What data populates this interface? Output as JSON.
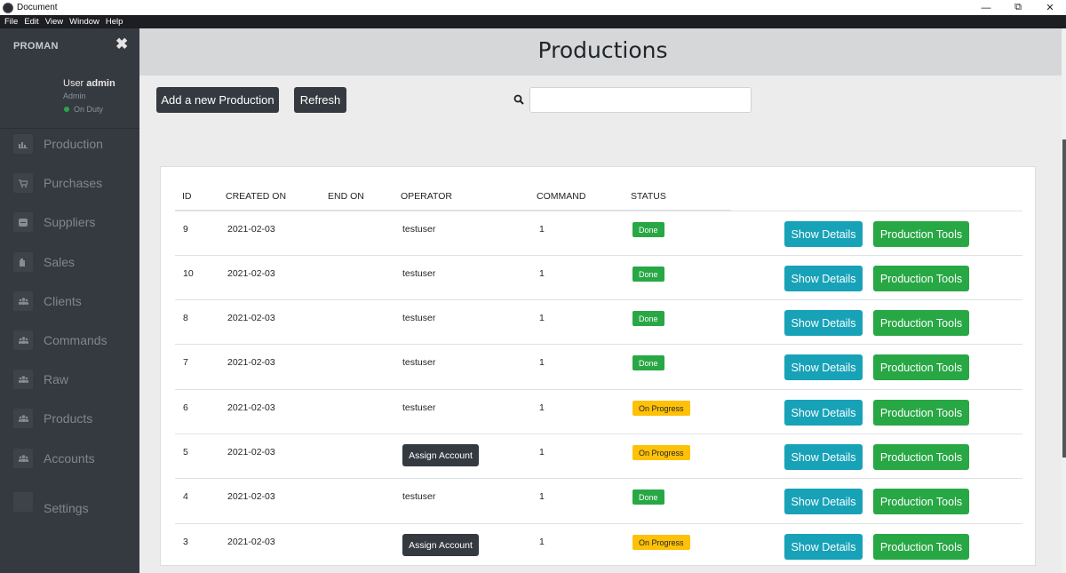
{
  "window": {
    "title": "Document",
    "controls": [
      "minimize",
      "restore",
      "close"
    ]
  },
  "menu": {
    "items": [
      "File",
      "Edit",
      "View",
      "Window",
      "Help"
    ]
  },
  "sidebar": {
    "brand": "PROMAN",
    "close_icon": "close-icon",
    "user": {
      "prefix": "User",
      "name": "admin",
      "role": "Admin",
      "status": "On Duty",
      "status_color": "#28a745"
    },
    "items": [
      {
        "label": "Production",
        "icon": "chart-icon"
      },
      {
        "label": "Purchases",
        "icon": "cart-icon"
      },
      {
        "label": "Suppliers",
        "icon": "box-icon"
      },
      {
        "label": "Sales",
        "icon": "building-icon"
      },
      {
        "label": "Clients",
        "icon": "users-icon"
      },
      {
        "label": "Commands",
        "icon": "users-icon"
      },
      {
        "label": "Raw",
        "icon": "users-icon"
      },
      {
        "label": "Products",
        "icon": "users-icon"
      },
      {
        "label": "Accounts",
        "icon": "users-icon"
      },
      {
        "label": "Settings",
        "icon": "gear-icon"
      }
    ]
  },
  "header": {
    "title": "Productions"
  },
  "toolbar": {
    "add_label": "Add a new Production",
    "refresh_label": "Refresh",
    "search_placeholder": "",
    "search_value": ""
  },
  "table": {
    "columns": [
      "ID",
      "CREATED ON",
      "END ON",
      "OPERATOR",
      "COMMAND",
      "STATUS"
    ],
    "rows": [
      {
        "id": "9",
        "created_on": "2021-02-03",
        "end_on": "",
        "operator": "testuser",
        "command": "1",
        "status": "Done"
      },
      {
        "id": "10",
        "created_on": "2021-02-03",
        "end_on": "",
        "operator": "testuser",
        "command": "1",
        "status": "Done"
      },
      {
        "id": "8",
        "created_on": "2021-02-03",
        "end_on": "",
        "operator": "testuser",
        "command": "1",
        "status": "Done"
      },
      {
        "id": "7",
        "created_on": "2021-02-03",
        "end_on": "",
        "operator": "testuser",
        "command": "1",
        "status": "Done"
      },
      {
        "id": "6",
        "created_on": "2021-02-03",
        "end_on": "",
        "operator": "testuser",
        "command": "1",
        "status": "On Progress"
      },
      {
        "id": "5",
        "created_on": "2021-02-03",
        "end_on": "",
        "operator": "Assign Account",
        "command": "1",
        "status": "On Progress"
      },
      {
        "id": "4",
        "created_on": "2021-02-03",
        "end_on": "",
        "operator": "testuser",
        "command": "1",
        "status": "Done"
      },
      {
        "id": "3",
        "created_on": "2021-02-03",
        "end_on": "",
        "operator": "Assign Account",
        "command": "1",
        "status": "On Progress"
      }
    ],
    "actions": {
      "details_label": "Show Details",
      "tools_label": "Production Tools"
    }
  },
  "colors": {
    "sidebar": "#343a40",
    "info": "#17a2b8",
    "success": "#28a745",
    "warning": "#ffc107",
    "dark": "#343a40"
  }
}
